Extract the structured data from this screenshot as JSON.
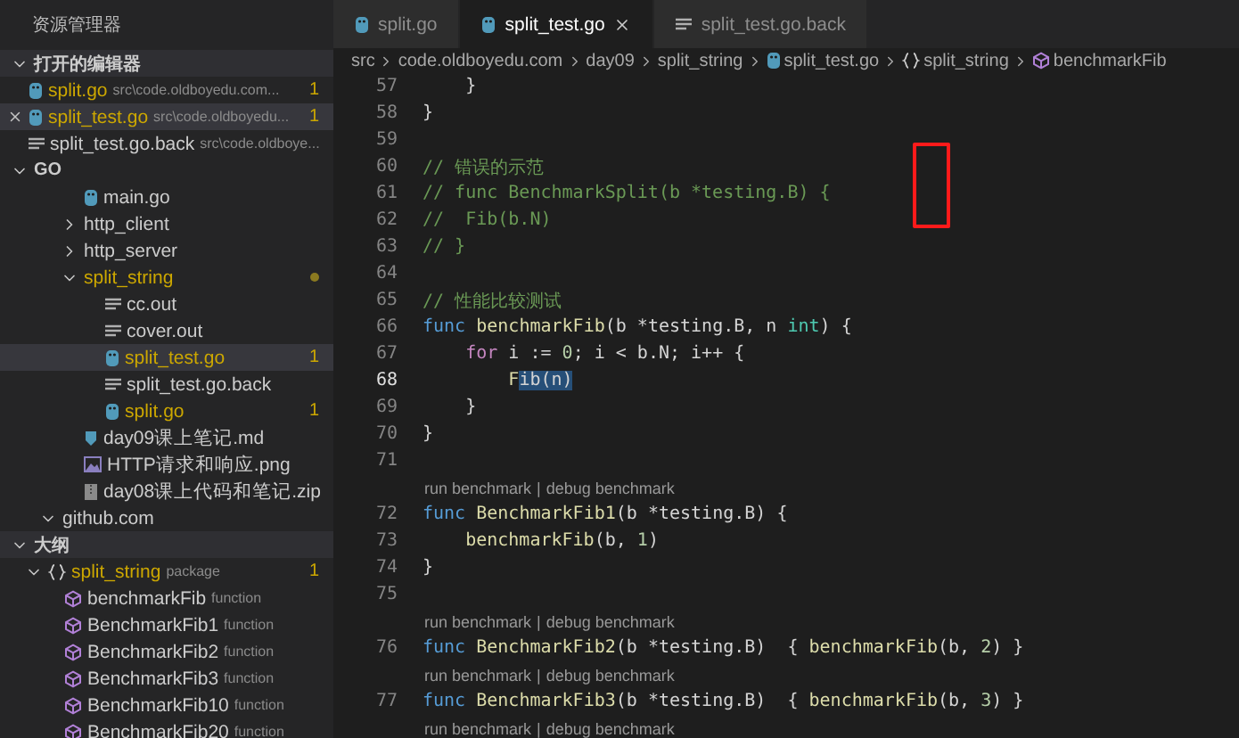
{
  "sidebar": {
    "title": "资源管理器",
    "open_editors": {
      "title": "打开的编辑器",
      "expanded": true,
      "items": [
        {
          "label": "split.go",
          "path": "src\\code.oldboyedu.com...",
          "badge": "1",
          "kind": "go",
          "warning": true,
          "selected": false
        },
        {
          "label": "split_test.go",
          "path": "src\\code.oldboyedu...",
          "badge": "1",
          "kind": "go",
          "warning": true,
          "selected": true
        },
        {
          "label": "split_test.go.back",
          "path": "src\\code.oldboye...",
          "kind": "text",
          "warning": false,
          "selected": false
        }
      ]
    },
    "workspace": {
      "title": "GO",
      "expanded": true,
      "items": [
        {
          "label": "main.go",
          "kind": "go",
          "warning": false,
          "selected": false
        },
        {
          "label": "http_client",
          "kind": "folder",
          "expanded": false,
          "warning": false,
          "selected": false
        },
        {
          "label": "http_server",
          "kind": "folder",
          "expanded": false,
          "warning": false,
          "selected": false
        },
        {
          "label": "split_string",
          "kind": "folder",
          "expanded": true,
          "warning": true,
          "modified": true,
          "selected": false,
          "children": [
            {
              "label": "cc.out",
              "kind": "text",
              "warning": false,
              "selected": false
            },
            {
              "label": "cover.out",
              "kind": "text",
              "warning": false,
              "selected": false
            },
            {
              "label": "split_test.go",
              "kind": "go",
              "warning": true,
              "badge": "1",
              "selected": true
            },
            {
              "label": "split_test.go.back",
              "kind": "text",
              "warning": false,
              "selected": false
            },
            {
              "label": "split.go",
              "kind": "go",
              "warning": true,
              "badge": "1",
              "selected": false
            }
          ]
        },
        {
          "label": "day09课上笔记.md",
          "kind": "markdown",
          "warning": false,
          "selected": false
        },
        {
          "label": "HTTP请求和响应.png",
          "kind": "image",
          "warning": false,
          "selected": false
        },
        {
          "label": "day08课上代码和笔记.zip",
          "kind": "zip",
          "warning": false,
          "selected": false
        }
      ],
      "trailing": [
        {
          "label": "github.com",
          "kind": "folder",
          "expanded": true,
          "warning": false,
          "selected": false
        }
      ]
    },
    "outline": {
      "title": "大纲",
      "expanded": true,
      "items": [
        {
          "label": "split_string",
          "detail": "package",
          "kind": "package",
          "badge": "1",
          "expanded": true,
          "warning": true,
          "children": [
            {
              "label": "benchmarkFib",
              "detail": "function",
              "kind": "function"
            },
            {
              "label": "BenchmarkFib1",
              "detail": "function",
              "kind": "function"
            },
            {
              "label": "BenchmarkFib2",
              "detail": "function",
              "kind": "function"
            },
            {
              "label": "BenchmarkFib3",
              "detail": "function",
              "kind": "function"
            },
            {
              "label": "BenchmarkFib10",
              "detail": "function",
              "kind": "function"
            },
            {
              "label": "BenchmarkFib20",
              "detail": "function",
              "kind": "function"
            }
          ]
        }
      ]
    }
  },
  "tabs": [
    {
      "label": "split.go",
      "kind": "go",
      "selected": false
    },
    {
      "label": "split_test.go",
      "kind": "go",
      "selected": true
    },
    {
      "label": "split_test.go.back",
      "kind": "text",
      "selected": false
    }
  ],
  "breadcrumb": [
    {
      "label": "src",
      "kind": "plain"
    },
    {
      "label": "code.oldboyedu.com",
      "kind": "plain"
    },
    {
      "label": "day09",
      "kind": "plain"
    },
    {
      "label": "split_string",
      "kind": "plain"
    },
    {
      "label": "split_test.go",
      "kind": "go"
    },
    {
      "label": "split_string",
      "kind": "package"
    },
    {
      "label": "benchmarkFib",
      "kind": "function"
    }
  ],
  "editor": {
    "lines": [
      {
        "kind": "code",
        "number": "57",
        "current": false,
        "tokens": [
          {
            "kind": "plain",
            "text": "    }"
          }
        ]
      },
      {
        "kind": "code",
        "number": "58",
        "current": false,
        "tokens": [
          {
            "kind": "plain",
            "text": "}"
          }
        ]
      },
      {
        "kind": "code",
        "number": "59",
        "current": false
      },
      {
        "kind": "code",
        "number": "60",
        "current": false,
        "tokens": [
          {
            "kind": "comment",
            "text": "// 错误的示范"
          }
        ]
      },
      {
        "kind": "code",
        "number": "61",
        "current": false,
        "tokens": [
          {
            "kind": "comment",
            "text": "// func BenchmarkSplit(b *testing.B) {"
          }
        ]
      },
      {
        "kind": "code",
        "number": "62",
        "current": false,
        "tokens": [
          {
            "kind": "comment",
            "text": "//  Fib(b.N)"
          }
        ]
      },
      {
        "kind": "code",
        "number": "63",
        "current": false,
        "tokens": [
          {
            "kind": "comment",
            "text": "// }"
          }
        ]
      },
      {
        "kind": "code",
        "number": "64",
        "current": false
      },
      {
        "kind": "code",
        "number": "65",
        "current": false,
        "tokens": [
          {
            "kind": "comment",
            "text": "// 性能比较测试"
          }
        ]
      },
      {
        "kind": "code",
        "number": "66",
        "current": false,
        "tokens": [
          {
            "kind": "keyword",
            "text": "func "
          },
          {
            "kind": "function",
            "text": "benchmarkFib"
          },
          {
            "kind": "plain",
            "text": "(b *testing.B, n "
          },
          {
            "kind": "type",
            "text": "int"
          },
          {
            "kind": "plain",
            "text": ") {"
          }
        ]
      },
      {
        "kind": "code",
        "number": "67",
        "current": false,
        "tokens": [
          {
            "kind": "control",
            "text": "    for"
          },
          {
            "kind": "plain",
            "text": " i := "
          },
          {
            "kind": "number",
            "text": "0"
          },
          {
            "kind": "plain",
            "text": "; i < b.N; i++ {"
          }
        ]
      },
      {
        "kind": "code",
        "number": "68",
        "current": true,
        "tokens": [
          {
            "kind": "function",
            "text": "        F"
          },
          {
            "kind": "selection",
            "text": "ib(n)"
          }
        ]
      },
      {
        "kind": "code",
        "number": "69",
        "current": false,
        "tokens": [
          {
            "kind": "plain",
            "text": "    }"
          }
        ]
      },
      {
        "kind": "code",
        "number": "70",
        "current": false,
        "tokens": [
          {
            "kind": "plain",
            "text": "}"
          }
        ]
      },
      {
        "kind": "code",
        "number": "71",
        "current": false
      },
      {
        "kind": "codelens",
        "run": "run benchmark",
        "separator": "|",
        "debug": "debug benchmark"
      },
      {
        "kind": "code",
        "number": "72",
        "current": false,
        "tokens": [
          {
            "kind": "keyword",
            "text": "func "
          },
          {
            "kind": "function",
            "text": "BenchmarkFib1"
          },
          {
            "kind": "plain",
            "text": "(b *testing.B) {"
          }
        ]
      },
      {
        "kind": "code",
        "number": "73",
        "current": false,
        "tokens": [
          {
            "kind": "function",
            "text": "    benchmarkFib"
          },
          {
            "kind": "plain",
            "text": "(b, "
          },
          {
            "kind": "number",
            "text": "1"
          },
          {
            "kind": "plain",
            "text": ")"
          }
        ]
      },
      {
        "kind": "code",
        "number": "74",
        "current": false,
        "tokens": [
          {
            "kind": "plain",
            "text": "}"
          }
        ]
      },
      {
        "kind": "code",
        "number": "75",
        "current": false
      },
      {
        "kind": "codelens",
        "run": "run benchmark",
        "separator": "|",
        "debug": "debug benchmark"
      },
      {
        "kind": "code",
        "number": "76",
        "current": false,
        "tokens": [
          {
            "kind": "keyword",
            "text": "func "
          },
          {
            "kind": "function",
            "text": "BenchmarkFib2"
          },
          {
            "kind": "plain",
            "text": "(b *testing.B)  { "
          },
          {
            "kind": "function",
            "text": "benchmarkFib"
          },
          {
            "kind": "plain",
            "text": "(b, "
          },
          {
            "kind": "number",
            "text": "2"
          },
          {
            "kind": "plain",
            "text": ") }"
          }
        ]
      },
      {
        "kind": "codelens",
        "run": "run benchmark",
        "separator": "|",
        "debug": "debug benchmark"
      },
      {
        "kind": "code",
        "number": "77",
        "current": false,
        "tokens": [
          {
            "kind": "keyword",
            "text": "func "
          },
          {
            "kind": "function",
            "text": "BenchmarkFib3"
          },
          {
            "kind": "plain",
            "text": "(b *testing.B)  { "
          },
          {
            "kind": "function",
            "text": "benchmarkFib"
          },
          {
            "kind": "plain",
            "text": "(b, "
          },
          {
            "kind": "number",
            "text": "3"
          },
          {
            "kind": "plain",
            "text": ") }"
          }
        ]
      },
      {
        "kind": "codelens",
        "run": "run benchmark",
        "separator": "|",
        "debug": "debug benchmark"
      }
    ]
  }
}
